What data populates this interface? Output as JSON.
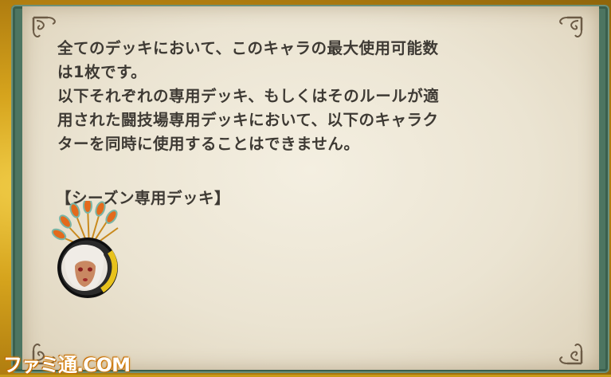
{
  "rules": {
    "paragraph1_line1": "全てのデッキにおいて、このキャラの最大使用可能数",
    "paragraph1_line2": "は1枚です。",
    "paragraph2_line1": "以下それぞれの専用デッキ、もしくはそのルールが適",
    "paragraph2_line2": "用された闘技場専用デッキにおいて、以下のキャラク",
    "paragraph2_line3": "ターを同時に使用することはできません。"
  },
  "section_heading": "【シーズン専用デッキ】",
  "character_icon": "character-portrait-icon",
  "watermark": "ファミ通.COM",
  "colors": {
    "paper": "#ebe4d2",
    "frame_green": "#4d7561",
    "frame_gold": "#d6a41d",
    "text": "#3e3a34"
  }
}
